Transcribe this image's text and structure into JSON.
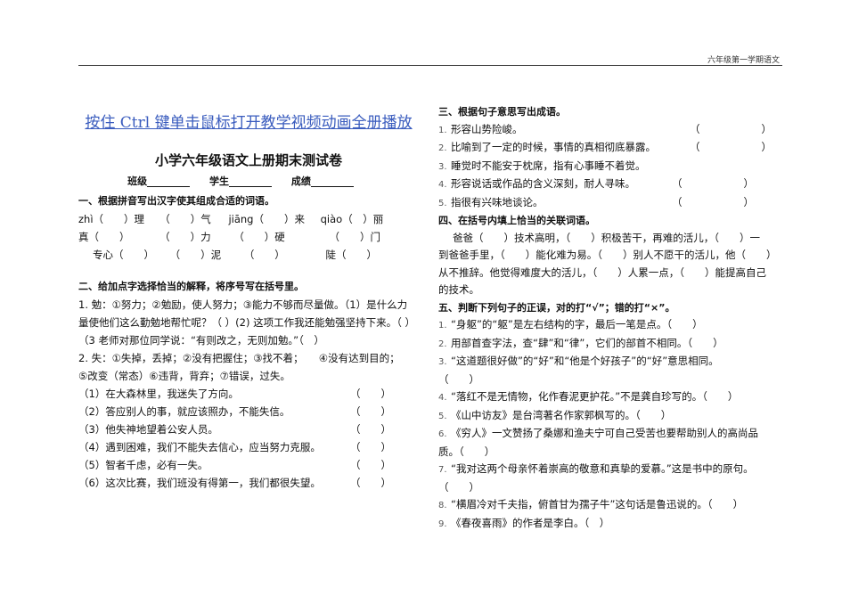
{
  "header": "六年级第一学期语文",
  "link_text": "按住 Ctrl 键单击鼠标打开教学视频动画全册播放",
  "title": "小学六年级语文上册期末测试卷",
  "info": {
    "class_label": "班级",
    "student_label": "学生",
    "score_label": "成绩"
  },
  "left": {
    "sec1": "一、根据拼音写出汉字使其组成合适的词语。",
    "pinyin_row1": [
      "zhì（　　）理　　（　　）气",
      "jiāng（　　）来",
      "qiào（　）丽"
    ],
    "pinyin_row2": [
      "真（　　）",
      "（　　）力",
      "（　　）硬",
      "（　　）门"
    ],
    "pinyin_row3": [
      "专心（　　）",
      "（　　）泥",
      "（　　）",
      "陡（　　）"
    ],
    "sec2": "二、给加点字选择恰当的解释，将序号写在括号里。",
    "q1_line1": "1. 勉：①努力；②勉励，使人努力；③能力不够而尽量做。（1）是什么力",
    "q1_line2": "量使他们这么勤勉地帮忙呢？（ ）(2) 这项工作我还能勉强坚持下来。（ ）",
    "q1_line3": "（3 老师对那位同学说：“有则改之，无则加勉。”（　）",
    "q2_line1": "2. 失：①失掉，丢掉；②没有把握住；③找不着；　　④没有达到目的；",
    "q2_line2": "⑤改变（常态）⑥违背，背弃；⑦错误，过失。",
    "q2_items": [
      "（1）在大森林里，我迷失了方向。",
      "（2）答应别人的事，就应该照办，不能失信。",
      "（3）他失神地望着公安人员。",
      "（4）遇到困难，我们不能失去信心，应当努力克服。",
      "（5）智者千虑，必有一失。",
      "（6）这次比赛，我们班没有得第一，我们都很失望。"
    ],
    "paren": "（　　）"
  },
  "right": {
    "sec3": "三、根据句子意思写出成语。",
    "q3_items": [
      {
        "n": "1.",
        "t": "形容山势险峻。",
        "p": "（　　　　　　）"
      },
      {
        "n": "2.",
        "t": "比喻到了一定的时候，事情的真相彻底暴露。",
        "p": "（　　　　　　）"
      },
      {
        "n": "3.",
        "t": "睡觉时不能安于枕席，指有心事睡不着觉。",
        "p": "（　　　　　　）"
      },
      {
        "n": "4.",
        "t": "形容说话或作品的含义深刻，耐人寻味。",
        "p": "（　　　　　　）"
      },
      {
        "n": "5.",
        "t": "指很有兴味地谈论。",
        "p": "（　　　　　　）"
      }
    ],
    "sec4": "四、在括号内填上恰当的关联词语。",
    "q4_line1": "爸爸（　　）技术高明，（　　）积极苦干，再难的活儿，（　　）一",
    "q4_line2": "到爸爸手里，（　　）能化难为易。（　　）别人不愿干的活儿，他（　　）",
    "q4_line3": "从不推辞。他觉得难度大的活儿，（　　）人累一点，（　　）能提高自己",
    "q4_line4": "的技术。",
    "sec5": "五、判断下列句子的正误，对的打“√”；错的打“×”。",
    "q5_items": [
      {
        "n": "1.",
        "t": "“身躯”的“躯”是左右结构的字，最后一笔是点。（　　）"
      },
      {
        "n": "2.",
        "t": "用部首查字法，查“肆”和“律”，它们的部首不相同。（　　）"
      },
      {
        "n": "3.",
        "t": "“这道题很好做”的“好”和“他是个好孩子”的“好”意思相同。",
        "t2": "（　　）"
      },
      {
        "n": "4.",
        "t": "“落红不是无情物，化作春泥更护花。”不是龚自珍写的。（　　）"
      },
      {
        "n": "5.",
        "t": "《山中访友》是台湾著名作家郭枫写的。（　　）"
      },
      {
        "n": "6.",
        "t": "《穷人》一文赞扬了桑娜和渔夫宁可自己受苦也要帮助别人的高尚品",
        "t2": "质。（　　）"
      },
      {
        "n": "7.",
        "t": "“我对这两个母亲怀着崇高的敬意和真挚的爱慕。”这是书中的原句。",
        "t2": "（　　）"
      },
      {
        "n": "8.",
        "t": "“横眉冷对千夫指，俯首甘为孺子牛”这句话是鲁迅说的。（　　）"
      },
      {
        "n": "9.",
        "t": "《春夜喜雨》的作者是李白。（　）"
      }
    ]
  }
}
